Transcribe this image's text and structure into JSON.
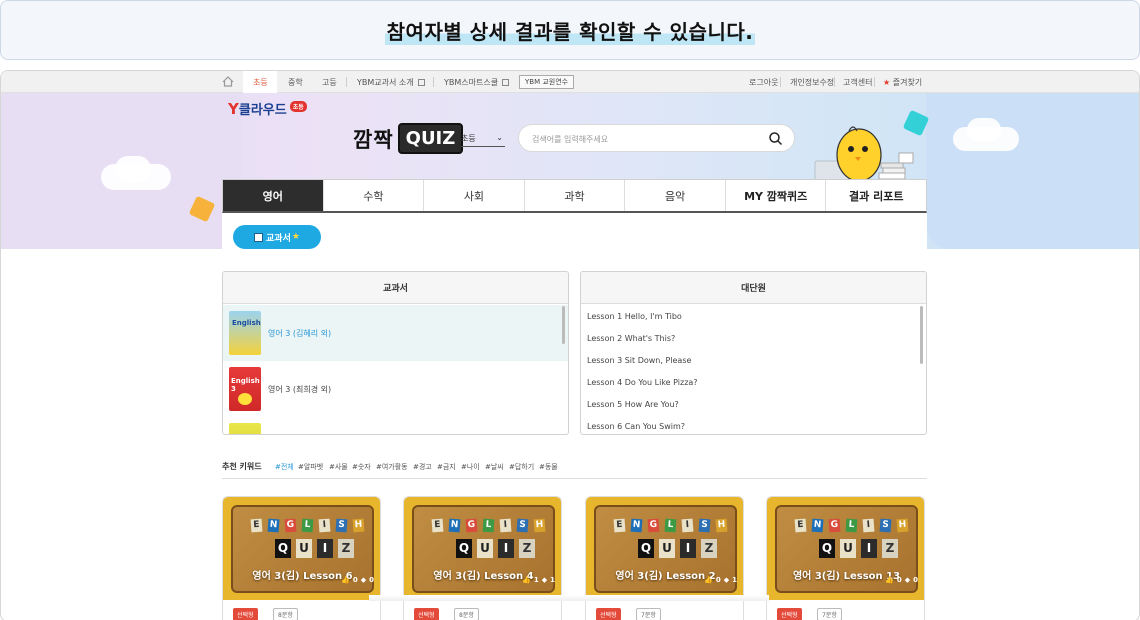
{
  "caption": "참여자별 상세 결과를 확인할 수 있습니다.",
  "topbar": {
    "nav": [
      "초등",
      "중학",
      "고등",
      "YBM교과서 소개",
      "YBM스마트스쿨"
    ],
    "teacher_button": "YBM 교원연수",
    "right_links": [
      "로그아웃",
      "개인정보수정",
      "고객센터",
      "즐겨찾기"
    ]
  },
  "logo": {
    "text": "클라우드",
    "badge": "초등"
  },
  "brand": {
    "korean": "깜짝",
    "quiz": "QUIZ"
  },
  "grade_select": {
    "value": "초등"
  },
  "search": {
    "placeholder": "검색어를 입력해주세요"
  },
  "tabs": [
    "영어",
    "수학",
    "사회",
    "과학",
    "음악",
    "MY 깜짝퀴즈",
    "결과 리포트"
  ],
  "chip": {
    "label": "교과서"
  },
  "textbook_panel": {
    "header": "교과서",
    "books": [
      {
        "title": "영어 3 (김혜리 외)",
        "selected": true
      },
      {
        "title": "영어 3 (최희경 외)",
        "selected": false
      }
    ]
  },
  "unit_panel": {
    "header": "대단원",
    "lessons": [
      "Lesson 1 Hello, I'm Tibo",
      "Lesson 2 What's This?",
      "Lesson 3 Sit Down, Please",
      "Lesson 4 Do You Like Pizza?",
      "Lesson 5 How Are You?",
      "Lesson 6 Can You Swim?"
    ]
  },
  "keywords": {
    "label": "추천 키워드",
    "items": [
      "#전체",
      "#알파벳",
      "#사물",
      "#숫자",
      "#여가활동",
      "#경고",
      "#금지",
      "#나이",
      "#날씨",
      "#답하기",
      "#동물"
    ]
  },
  "cards": [
    {
      "title": "영어 3(김) Lesson 6",
      "likes": "0",
      "shares": "0",
      "type": "선택형",
      "count": "8문항"
    },
    {
      "title": "영어 3(김) Lesson 4",
      "likes": "1",
      "shares": "1",
      "type": "선택형",
      "count": "8문항"
    },
    {
      "title": "영어 3(김) Lesson 2",
      "likes": "0",
      "shares": "1",
      "type": "선택형",
      "count": "7문항"
    },
    {
      "title": "영어 3(김) Lesson 13",
      "likes": "0",
      "shares": "0",
      "type": "선택형",
      "count": "7문항"
    }
  ],
  "card_letters": {
    "top": [
      "E",
      "N",
      "G",
      "L",
      "I",
      "S",
      "H"
    ],
    "bottom": [
      "Q",
      "U",
      "I",
      "Z"
    ]
  },
  "colors": {
    "accent_blue": "#1fa9e3",
    "tag_red": "#e44a3a",
    "active_nav": "#e05a3a"
  }
}
